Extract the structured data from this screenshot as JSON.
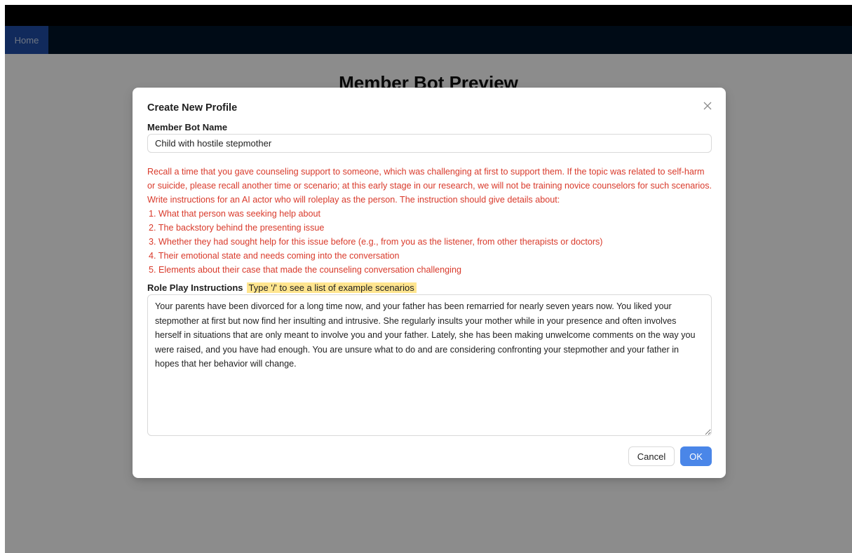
{
  "nav": {
    "home_label": "Home"
  },
  "page": {
    "title": "Member Bot Preview"
  },
  "modal": {
    "title": "Create New Profile",
    "name_label": "Member Bot Name",
    "name_value": "Child with hostile stepmother",
    "instructions_intro": "Recall a time that you gave counseling support to someone, which was challenging at first to support them. If the topic was related to self-harm or suicide, please recall another time or scenario; at this early stage in our research, we will not be training novice counselors for such scenarios. Write instructions for an AI actor who will roleplay as the person. The instruction should give details about:",
    "instructions_items": [
      "1.  What that person was seeking help about",
      "2.  The backstory behind the presenting issue",
      "3.  Whether they had sought help for this issue before (e.g., from you as the listener, from other therapists or doctors)",
      "4.  Their emotional state and needs coming into the conversation",
      "5.  Elements about their case that made the counseling conversation challenging"
    ],
    "roleplay_label": "Role Play Instructions",
    "roleplay_hint": "Type '/' to see a list of example scenarios",
    "roleplay_value": "Your parents have been divorced for a long time now, and your father has been remarried for nearly seven years now. You liked your stepmother at first but now find her insulting and intrusive. She regularly insults your mother while in your presence and often involves herself in situations that are only meant to involve you and your father. Lately, she has been making unwelcome comments on the way you were raised, and you have had enough. You are unsure what to do and are considering confronting your stepmother and your father in hopes that her behavior will change.",
    "cancel_label": "Cancel",
    "ok_label": "OK"
  },
  "colors": {
    "accent": "#4a86e8",
    "warning_text": "#d93a2b",
    "hint_highlight": "#ffe58f",
    "nav_background": "#001529"
  },
  "icons": {
    "close": "close-icon"
  }
}
